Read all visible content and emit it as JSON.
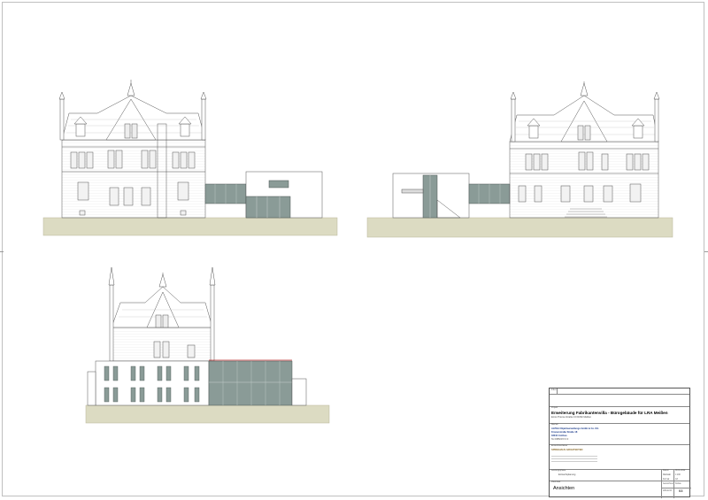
{
  "title_block": {
    "label_top": "Projekt",
    "project_title": "Erweiterung Fabrikantenvilla - Bürogebäude für LRA Meißen",
    "address": "Ernst-Thieme-Straße 13     01662 Meißen",
    "label_client": "Bauherr",
    "client_name": "ALPHA Objektverwaltungs GmbH & Co. KG",
    "client_street": "Kronenstraße Straße 18",
    "client_city": "03044 Cottbus",
    "client_phone": "Tel 0355/472 0 0",
    "label_architect": "Entwurfsverfasser",
    "architect_name": "SPREEHAUS ARCHITEKTEN",
    "label_phase": "Leistungsphase",
    "phase": "Entwurfsplanung",
    "label_plan": "Planinhalt",
    "plan_title": "Ansichten",
    "label_date": "Datum",
    "date": "08.11.2012",
    "label_scale": "Maßstab",
    "scale": "1:100",
    "label_size": "Format",
    "size": "A3",
    "label_drawn": "Gezeichnet",
    "drawn": "Kubas",
    "plan_no": "LRA-E 02",
    "sheet_no": "03",
    "label_index": "Index"
  }
}
